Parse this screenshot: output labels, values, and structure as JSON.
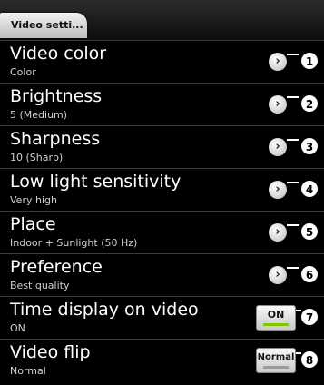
{
  "header": {
    "back_label": "Video setti..."
  },
  "settings": [
    {
      "title": "Video color",
      "summary": "Color",
      "callout": "1"
    },
    {
      "title": "Brightness",
      "summary": "5 (Medium)",
      "callout": "2"
    },
    {
      "title": "Sharpness",
      "summary": "10 (Sharp)",
      "callout": "3"
    },
    {
      "title": "Low light sensitivity",
      "summary": "Very high",
      "callout": "4"
    },
    {
      "title": "Place",
      "summary": "Indoor + Sunlight (50 Hz)",
      "callout": "5"
    },
    {
      "title": "Preference",
      "summary": "Best quality",
      "callout": "6"
    },
    {
      "title": "Time display on video",
      "summary": "ON",
      "button": "ON",
      "callout": "7"
    },
    {
      "title": "Video flip",
      "summary": "Normal",
      "button": "Normal",
      "callout": "8"
    }
  ],
  "icons": {
    "arrow": "chevron-right-icon"
  },
  "colors": {
    "toggle_on": "#7ec800",
    "background": "#000000"
  }
}
